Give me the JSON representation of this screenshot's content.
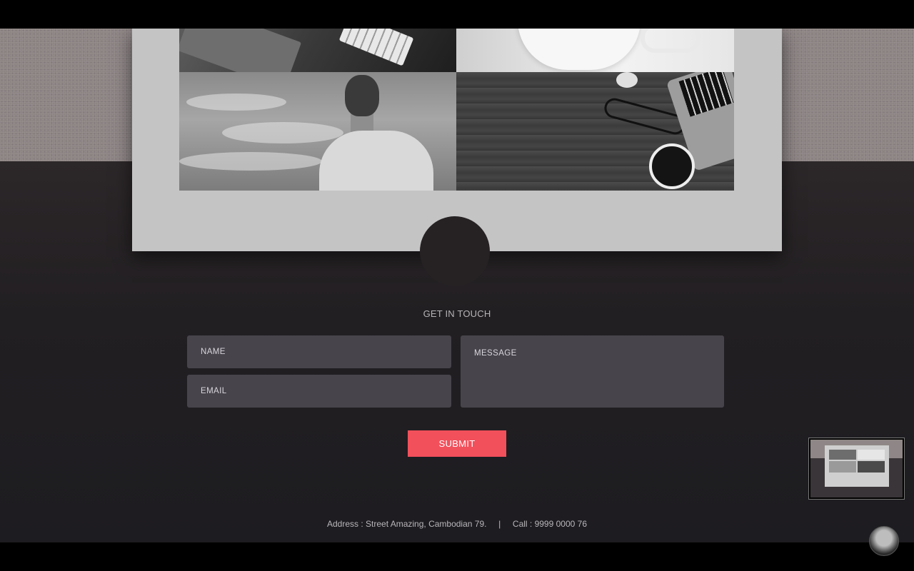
{
  "contact": {
    "title": "GET IN TOUCH",
    "name_placeholder": "NAME",
    "email_placeholder": "EMAIL",
    "message_placeholder": "MESSAGE",
    "submit_label": "SUBMIT"
  },
  "footer": {
    "text": "Address : Street Amazing, Cambodian 79.     |     Call : 9999 0000 76"
  },
  "colors": {
    "accent": "#f2505b",
    "field_bg": "#47444c",
    "card_bg": "#c4c4c4",
    "band_top": "#8d8484",
    "page_bg": "#221f22"
  },
  "gallery": {
    "tiles": [
      "notebook-keyboard-photo",
      "coffee-mug-photo",
      "man-looking-away-photo",
      "desk-laptop-coffee-photo"
    ]
  }
}
